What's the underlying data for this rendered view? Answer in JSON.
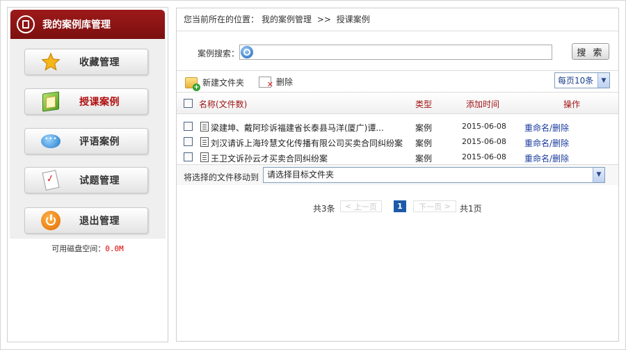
{
  "sidebar": {
    "title": "我的案例库管理",
    "items": [
      {
        "label": "收藏管理",
        "icon": "star-icon",
        "active": false
      },
      {
        "label": "授课案例",
        "icon": "book-icon",
        "active": true
      },
      {
        "label": "评语案例",
        "icon": "chat-bubble-icon",
        "active": false
      },
      {
        "label": "试题管理",
        "icon": "exam-paper-icon",
        "active": false
      },
      {
        "label": "退出管理",
        "icon": "power-icon",
        "active": false
      }
    ],
    "disk_label": "可用磁盘空间：",
    "disk_value": "0.0M"
  },
  "breadcrumb": {
    "prefix": "您当前所在的位置：",
    "parent": "我的案例管理",
    "separator": ">>",
    "current": "授课案例"
  },
  "search": {
    "label": "案例搜索：",
    "value": "",
    "button": "搜 索"
  },
  "toolbar": {
    "new_folder": "新建文件夹",
    "delete": "删除",
    "per_page": "每页10条"
  },
  "table": {
    "headers": {
      "name": "名称(文件数)",
      "type": "类型",
      "date": "添加时间",
      "ops": "操作"
    },
    "rows": [
      {
        "name": "梁建坤、戴阿珍诉福建省长泰县马洋(厦广)谭...",
        "type": "案例",
        "date": "2015-06-08",
        "ops": "重命名/删除"
      },
      {
        "name": "刘汉请诉上海玲慧文化传播有限公司买卖合同纠纷案",
        "type": "案例",
        "date": "2015-06-08",
        "ops": "重命名/删除"
      },
      {
        "name": "王卫文诉孙云才买卖合同纠纷案",
        "type": "案例",
        "date": "2015-06-08",
        "ops": "重命名/删除"
      }
    ]
  },
  "move": {
    "label": "将选择的文件移动到",
    "selected": "请选择目标文件夹"
  },
  "pager": {
    "total": "共3条",
    "prev": "上一页",
    "current": "1",
    "next": "下一页",
    "pages": "共1页"
  }
}
